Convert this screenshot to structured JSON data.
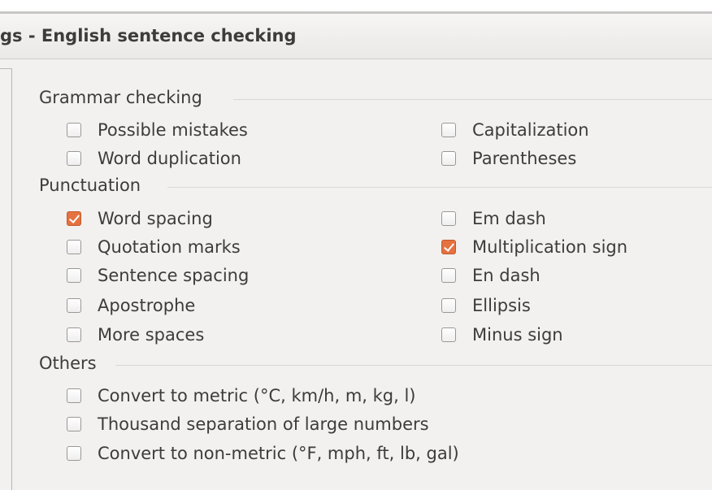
{
  "dialog": {
    "title": "gs - English sentence checking"
  },
  "sections": {
    "grammar": {
      "label": "Grammar checking",
      "options": [
        {
          "label": "Possible mistakes",
          "checked": false
        },
        {
          "label": "Capitalization",
          "checked": false
        },
        {
          "label": "Word duplication",
          "checked": false
        },
        {
          "label": "Parentheses",
          "checked": false
        }
      ]
    },
    "punctuation": {
      "label": "Punctuation",
      "options": [
        {
          "label": "Word spacing",
          "checked": true
        },
        {
          "label": "Em dash",
          "checked": false
        },
        {
          "label": "Quotation marks",
          "checked": false
        },
        {
          "label": "Multiplication sign",
          "checked": true
        },
        {
          "label": "Sentence spacing",
          "checked": false
        },
        {
          "label": "En dash",
          "checked": false
        },
        {
          "label": "Apostrophe",
          "checked": false
        },
        {
          "label": "Ellipsis",
          "checked": false
        },
        {
          "label": "More spaces",
          "checked": false
        },
        {
          "label": "Minus sign",
          "checked": false
        }
      ]
    },
    "others": {
      "label": "Others",
      "options": [
        {
          "label": "Convert to metric (°C, km/h, m, kg, l)",
          "checked": false
        },
        {
          "label": "Thousand separation of large numbers",
          "checked": false
        },
        {
          "label": "Convert to non-metric (°F, mph, ft, lb, gal)",
          "checked": false
        }
      ]
    }
  },
  "colors": {
    "checked_fill": "#e5723f",
    "background": "#f2f1f0"
  }
}
